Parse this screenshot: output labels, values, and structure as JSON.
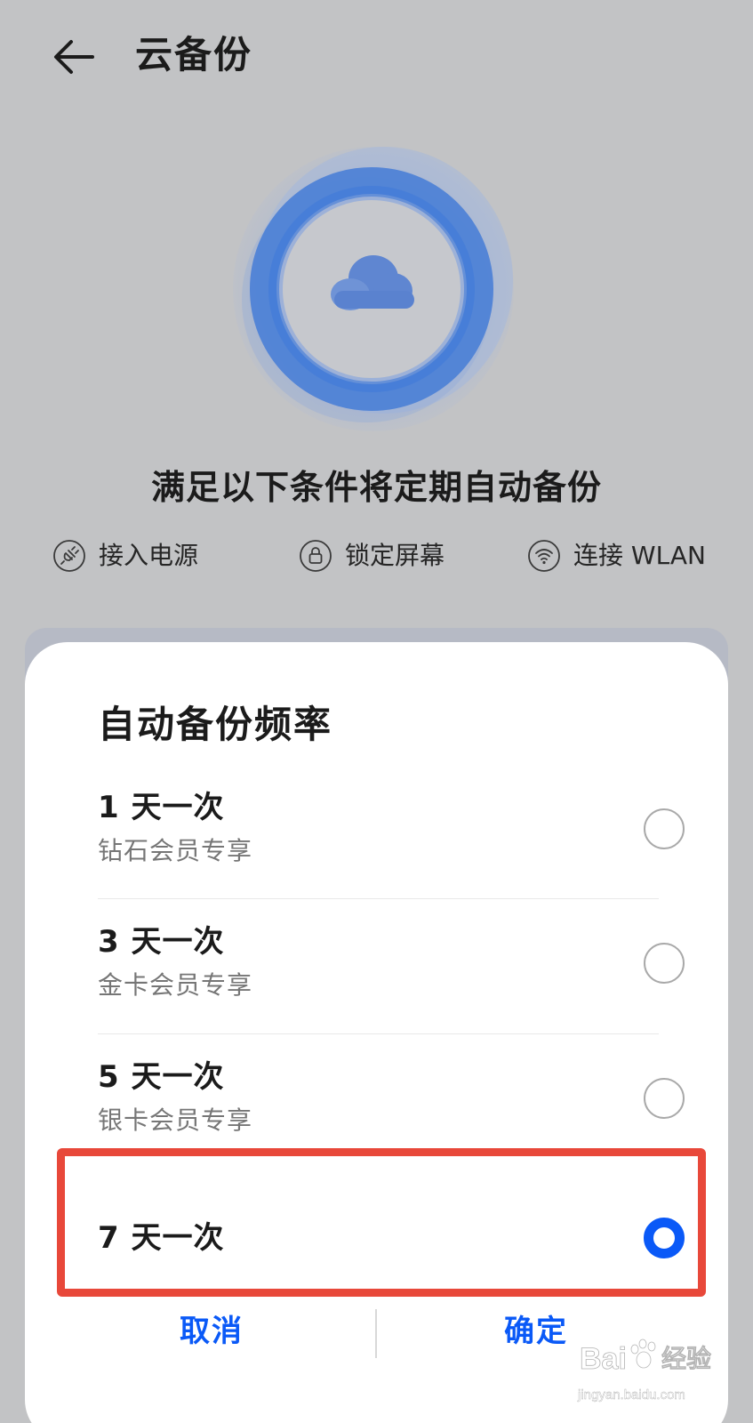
{
  "header": {
    "title": "云备份",
    "back_icon": "arrow-left-icon"
  },
  "hero": {
    "icon": "cloud-icon",
    "ring_color": "#4f82d8"
  },
  "subtitle": "满足以下条件将定期自动备份",
  "conditions": [
    {
      "icon": "power-plug-icon",
      "label": "接入电源"
    },
    {
      "icon": "lock-icon",
      "label": "锁定屏幕"
    },
    {
      "icon": "wifi-icon",
      "label": "连接 WLAN"
    }
  ],
  "dialog": {
    "title": "自动备份频率",
    "options": [
      {
        "label": "1 天一次",
        "sub": "钻石会员专享",
        "selected": false
      },
      {
        "label": "3 天一次",
        "sub": "金卡会员专享",
        "selected": false
      },
      {
        "label": "5 天一次",
        "sub": "银卡会员专享",
        "selected": false
      },
      {
        "label": "7 天一次",
        "sub": "",
        "selected": true
      }
    ],
    "cancel_label": "取消",
    "confirm_label": "确定"
  },
  "watermark": {
    "brand": "Bai",
    "brand_suffix": "经验",
    "url": "jingyan.baidu.com"
  },
  "colors": {
    "accent": "#0a59f7",
    "highlight_box": "#e8483a",
    "page_background": "#c2c3c5"
  }
}
